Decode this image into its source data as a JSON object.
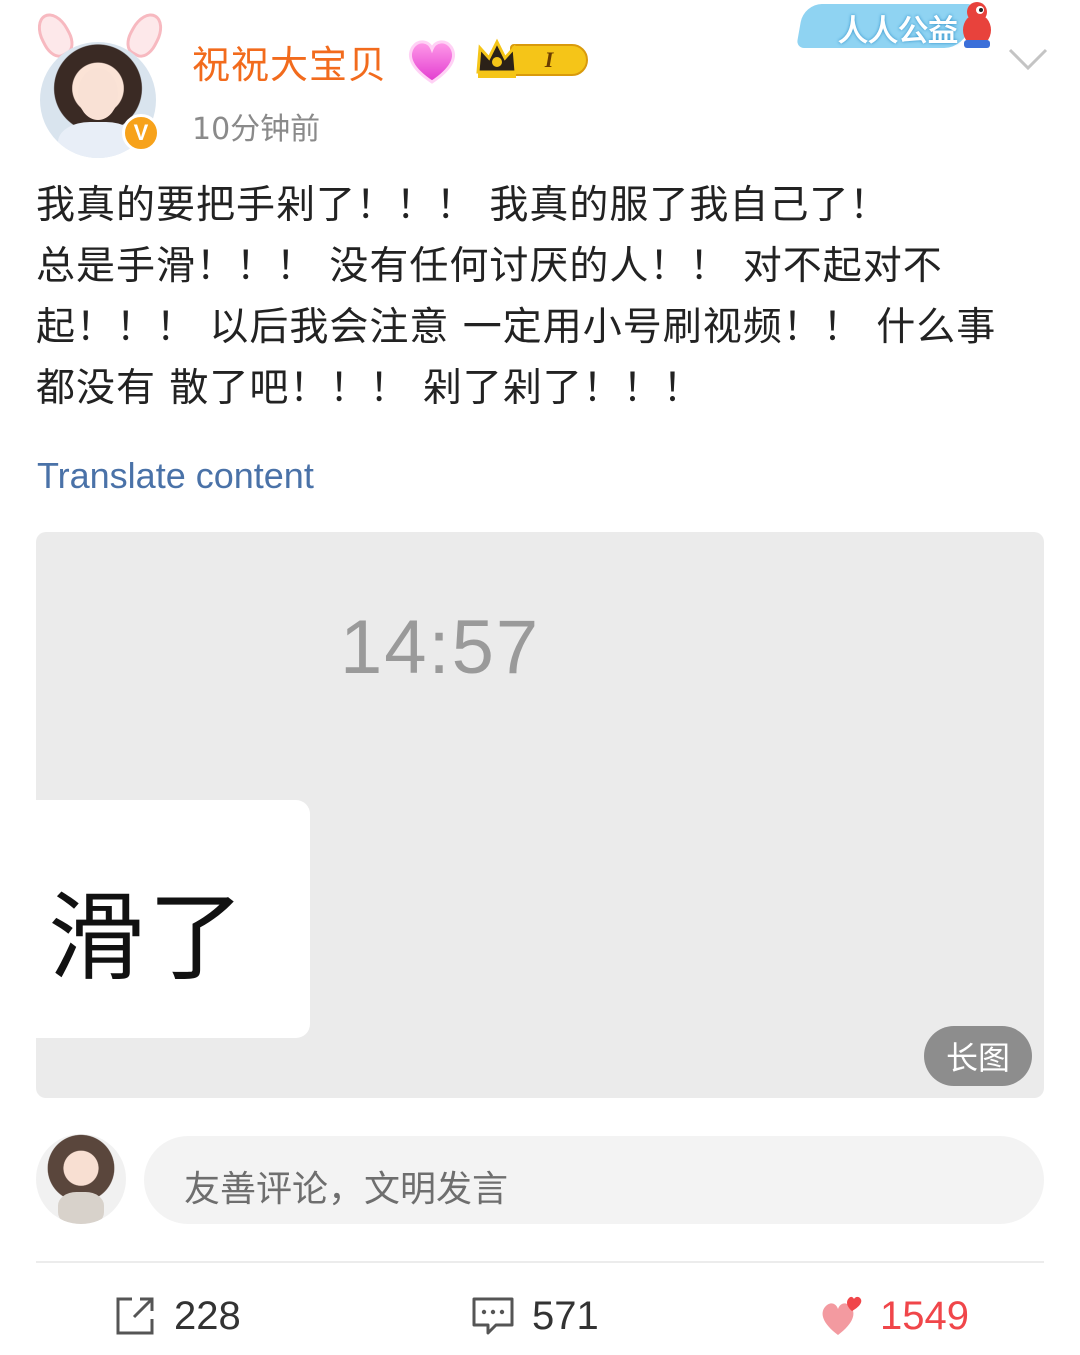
{
  "header": {
    "username": "祝祝大宝贝",
    "level_badge": "I",
    "time": "10分钟前",
    "charity_label": "人人公益"
  },
  "post": {
    "lines": [
      "我真的要把手剁了！！！ 我真的服了我自己了！",
      "总是手滑！！！ 没有任何讨厌的人！！ 对不起对不",
      "起！！！ 以后我会注意 一定用小号刷视频！！ 什么事",
      "都没有 散了吧！！！ 剁了剁了！！！"
    ],
    "translate_link": "Translate content"
  },
  "image": {
    "clock": "14:57",
    "bubble_text": "滑了",
    "long_image_badge": "长图"
  },
  "comment_input": {
    "placeholder": "友善评论，文明发言"
  },
  "actions": {
    "repost_count": "228",
    "comment_count": "571",
    "like_count": "1549"
  },
  "colors": {
    "username": "#f26b1d",
    "link": "#4a72a8",
    "like": "#f0464a",
    "verified": "#f7a21b"
  },
  "icons": [
    "rabbit-ears-icon",
    "verified-v-icon",
    "heart-badge-icon",
    "crown-icon",
    "chevron-down-icon",
    "repost-icon",
    "comment-icon",
    "like-heart-icon"
  ]
}
